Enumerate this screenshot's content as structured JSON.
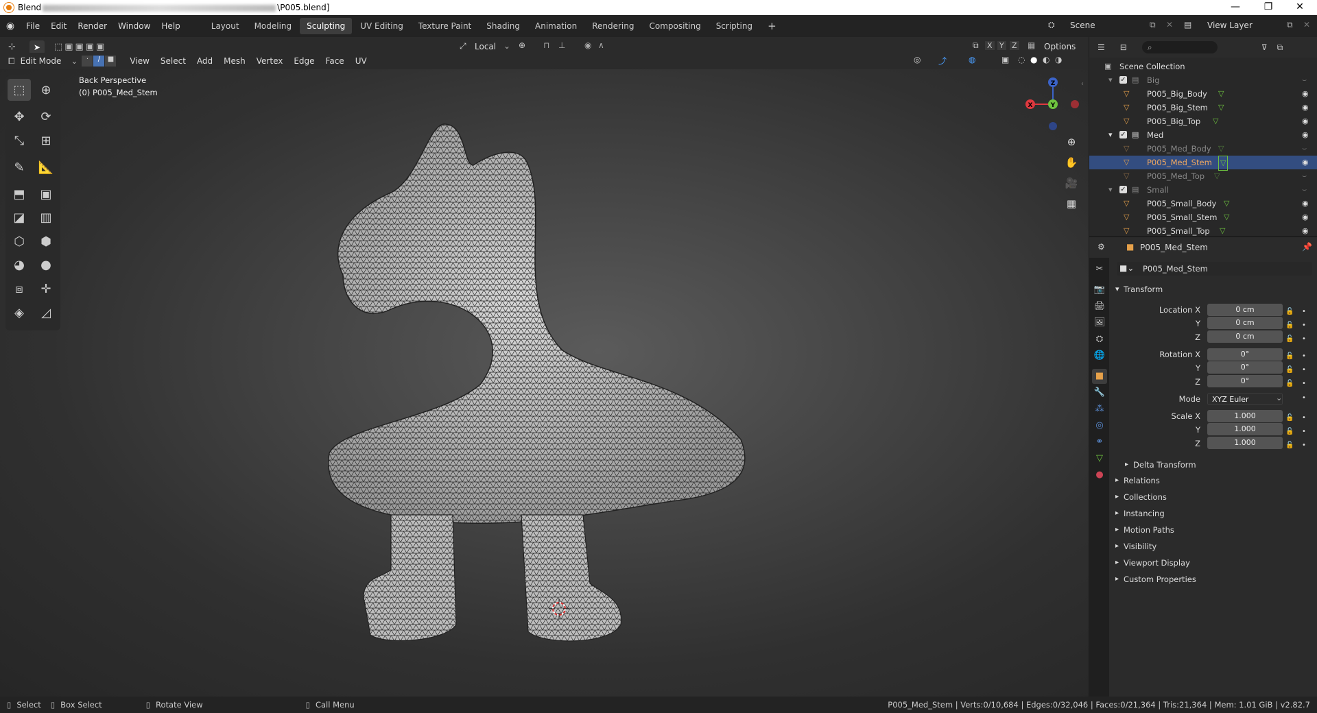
{
  "titlebar": {
    "app_name": "Blend",
    "file_suffix": "\\P005.blend]",
    "minimize": "—",
    "restore": "❐",
    "close": "✕"
  },
  "menus": [
    "File",
    "Edit",
    "Render",
    "Window",
    "Help"
  ],
  "workspaces": [
    "Layout",
    "Modeling",
    "Sculpting",
    "UV Editing",
    "Texture Paint",
    "Shading",
    "Animation",
    "Rendering",
    "Compositing",
    "Scripting"
  ],
  "active_workspace": "Sculpting",
  "add_workspace": "+",
  "scene": {
    "label": "Scene"
  },
  "view_layer": {
    "label": "View Layer"
  },
  "header": {
    "transform_orientation": "Local",
    "axes": [
      "X",
      "Y",
      "Z"
    ],
    "options": "Options",
    "mode": "Edit Mode",
    "view_menus": [
      "View",
      "Select",
      "Add",
      "Mesh",
      "Vertex",
      "Edge",
      "Face",
      "UV"
    ]
  },
  "viewport": {
    "view_name": "Back Perspective",
    "object_label": "(0) P005_Med_Stem"
  },
  "gizmo": {
    "x": "X",
    "y": "Y",
    "z": "Z"
  },
  "outliner": {
    "search_placeholder": "",
    "root": "Scene Collection",
    "collections": [
      {
        "name": "Big",
        "items": [
          "P005_Big_Body",
          "P005_Big_Stem",
          "P005_Big_Top"
        ]
      },
      {
        "name": "Med",
        "items": [
          "P005_Med_Body",
          "P005_Med_Stem",
          "P005_Med_Top"
        ]
      },
      {
        "name": "Small",
        "items": [
          "P005_Small_Body",
          "P005_Small_Stem",
          "P005_Small_Top"
        ]
      }
    ],
    "selected": "P005_Med_Stem"
  },
  "properties": {
    "object_name": "P005_Med_Stem",
    "datablock": "P005_Med_Stem",
    "transform_title": "Transform",
    "location_x_label": "Location X",
    "location_x": "0 cm",
    "location_y_label": "Y",
    "location_y": "0 cm",
    "location_z_label": "Z",
    "location_z": "0 cm",
    "rotation_x_label": "Rotation X",
    "rotation_x": "0°",
    "rotation_y_label": "Y",
    "rotation_y": "0°",
    "rotation_z_label": "Z",
    "rotation_z": "0°",
    "mode_label": "Mode",
    "mode": "XYZ Euler",
    "scale_x_label": "Scale X",
    "scale_x": "1.000",
    "scale_y_label": "Y",
    "scale_y": "1.000",
    "scale_z_label": "Z",
    "scale_z": "1.000",
    "delta": "Delta Transform",
    "panels": [
      "Relations",
      "Collections",
      "Instancing",
      "Motion Paths",
      "Visibility",
      "Viewport Display",
      "Custom Properties"
    ]
  },
  "status": {
    "select": "Select",
    "box_select": "Box Select",
    "rotate_view": "Rotate View",
    "call_menu": "Call Menu",
    "stats": "P005_Med_Stem | Verts:0/10,684 | Edges:0/32,046 | Faces:0/21,364 | Tris:21,364 | Mem: 1.01 GiB | v2.82.7"
  },
  "colors": {
    "selected_row": "#334d80",
    "accent_blue": "#4772b3",
    "axis_x": "#e0393f",
    "axis_y": "#6ec23f",
    "axis_z": "#3b63c8"
  }
}
